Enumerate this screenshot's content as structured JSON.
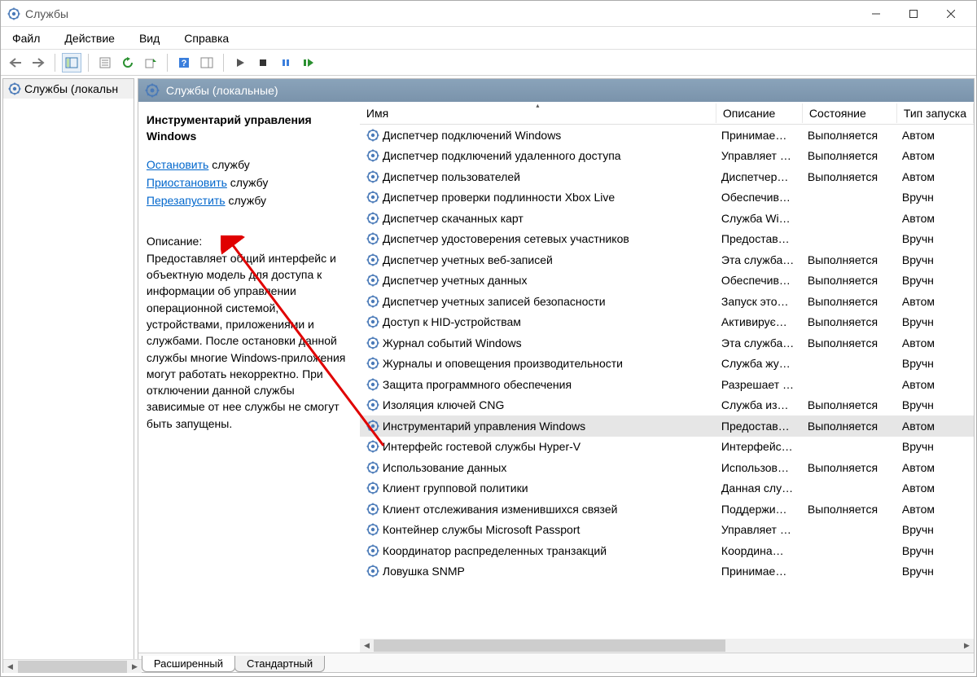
{
  "window": {
    "title": "Службы"
  },
  "menu": {
    "file": "Файл",
    "action": "Действие",
    "view": "Вид",
    "help": "Справка"
  },
  "tree": {
    "root": "Службы (локальн"
  },
  "content": {
    "header": "Службы (локальные)",
    "selected_name": "Инструментарий управления Windows",
    "actions": {
      "stop": "Остановить",
      "stop_suffix": " службу",
      "pause": "Приостановить",
      "pause_suffix": " службу",
      "restart": "Перезапустить",
      "restart_suffix": " службу"
    },
    "desc_label": "Описание:",
    "desc_text": "Предоставляет общий интерфейс и объектную модель для доступа к информации об управлении операционной системой, устройствами, приложениями и службами. После остановки данной службы многие Windows-приложения могут работать некорректно. При отключении данной службы зависимые от нее службы не смогут быть запущены."
  },
  "columns": {
    "name": "Имя",
    "desc": "Описание",
    "state": "Состояние",
    "type": "Тип запуска"
  },
  "tabs": {
    "extended": "Расширенный",
    "standard": "Стандартный"
  },
  "services": [
    {
      "name": "Диспетчер подключений Windows",
      "desc": "Принимае…",
      "state": "Выполняется",
      "type": "Автом"
    },
    {
      "name": "Диспетчер подключений удаленного доступа",
      "desc": "Управляет …",
      "state": "Выполняется",
      "type": "Автом"
    },
    {
      "name": "Диспетчер пользователей",
      "desc": "Диспетчер…",
      "state": "Выполняется",
      "type": "Автом"
    },
    {
      "name": "Диспетчер проверки подлинности Xbox Live",
      "desc": "Обеспечив…",
      "state": "",
      "type": "Вручн"
    },
    {
      "name": "Диспетчер скачанных карт",
      "desc": "Служба Wi…",
      "state": "",
      "type": "Автом"
    },
    {
      "name": "Диспетчер удостоверения сетевых участников",
      "desc": "Предостав…",
      "state": "",
      "type": "Вручн"
    },
    {
      "name": "Диспетчер учетных веб-записей",
      "desc": "Эта служба…",
      "state": "Выполняется",
      "type": "Вручн"
    },
    {
      "name": "Диспетчер учетных данных",
      "desc": "Обеспечив…",
      "state": "Выполняется",
      "type": "Вручн"
    },
    {
      "name": "Диспетчер учетных записей безопасности",
      "desc": "Запуск это…",
      "state": "Выполняется",
      "type": "Автом"
    },
    {
      "name": "Доступ к HID-устройствам",
      "desc": "Активирує…",
      "state": "Выполняется",
      "type": "Вручн"
    },
    {
      "name": "Журнал событий Windows",
      "desc": "Эта служба…",
      "state": "Выполняется",
      "type": "Автом"
    },
    {
      "name": "Журналы и оповещения производительности",
      "desc": "Служба жу…",
      "state": "",
      "type": "Вручн"
    },
    {
      "name": "Защита программного обеспечения",
      "desc": "Разрешает …",
      "state": "",
      "type": "Автом"
    },
    {
      "name": "Изоляция ключей CNG",
      "desc": "Служба из…",
      "state": "Выполняется",
      "type": "Вручн"
    },
    {
      "name": "Инструментарий управления Windows",
      "desc": "Предостав…",
      "state": "Выполняется",
      "type": "Автом",
      "selected": true
    },
    {
      "name": "Интерфейс гостевой службы Hyper-V",
      "desc": "Интерфейс…",
      "state": "",
      "type": "Вручн"
    },
    {
      "name": "Использование данных",
      "desc": "Использов…",
      "state": "Выполняется",
      "type": "Автом"
    },
    {
      "name": "Клиент групповой политики",
      "desc": "Данная слу…",
      "state": "",
      "type": "Автом"
    },
    {
      "name": "Клиент отслеживания изменившихся связей",
      "desc": "Поддержи…",
      "state": "Выполняется",
      "type": "Автом"
    },
    {
      "name": "Контейнер службы Microsoft Passport",
      "desc": "Управляет …",
      "state": "",
      "type": "Вручн"
    },
    {
      "name": "Координатор распределенных транзакций",
      "desc": "Координа…",
      "state": "",
      "type": "Вручн"
    },
    {
      "name": "Ловушка SNMP",
      "desc": "Принимае…",
      "state": "",
      "type": "Вручн"
    }
  ]
}
